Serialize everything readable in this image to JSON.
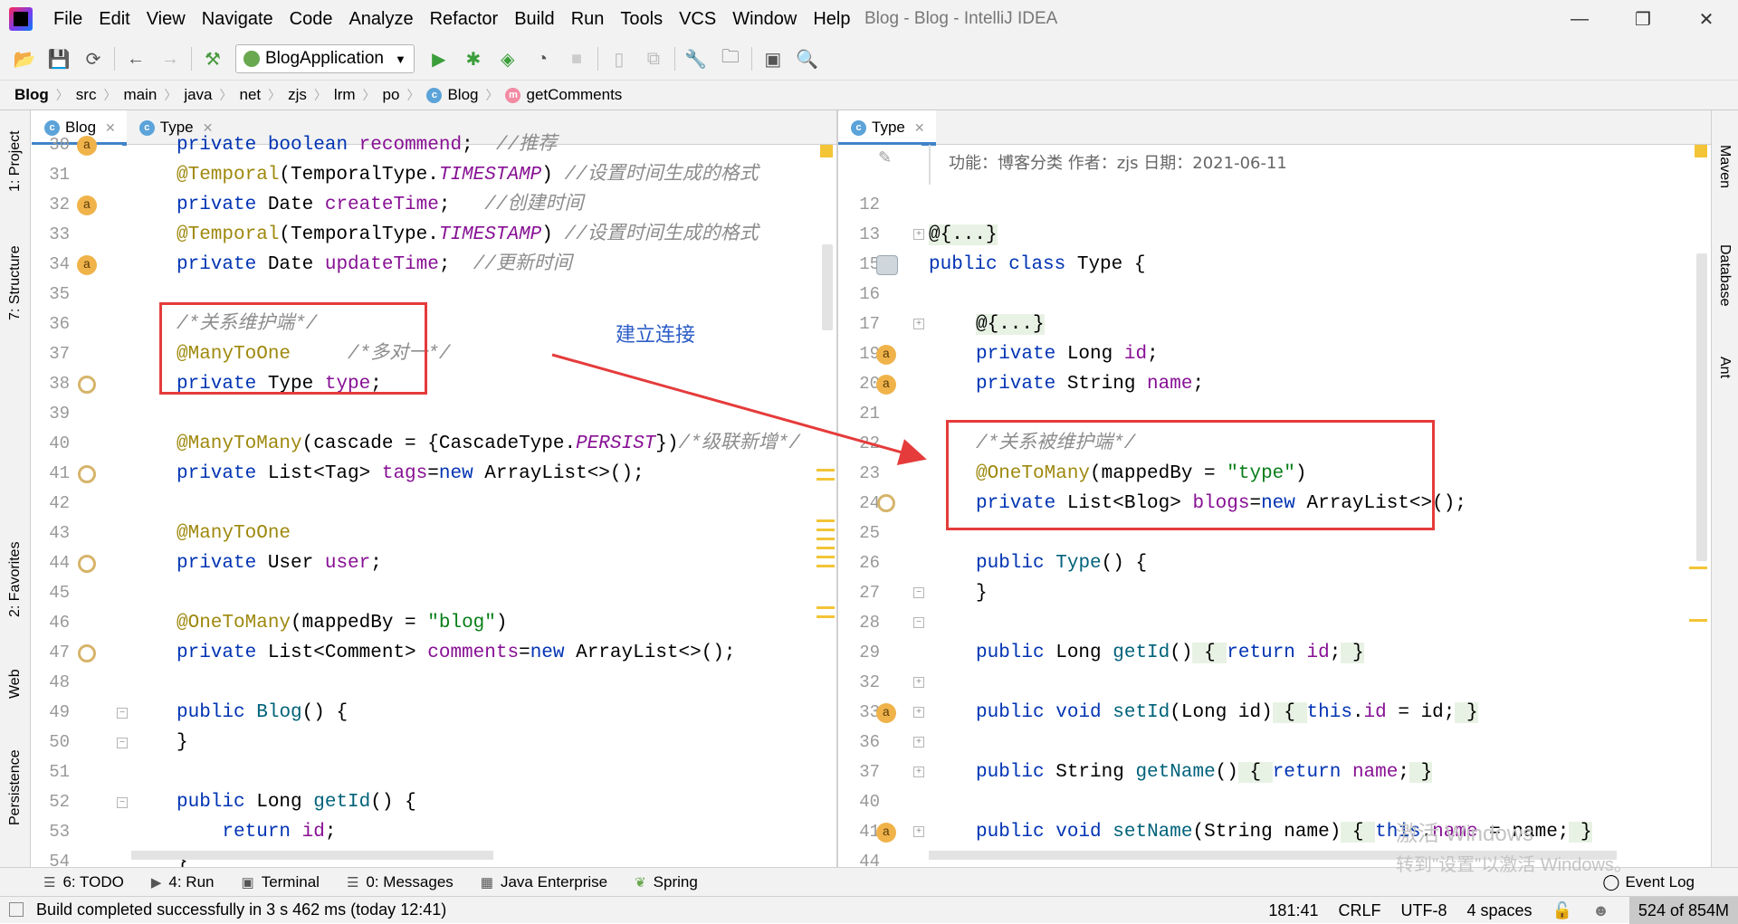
{
  "window": {
    "title": "Blog - Blog - IntelliJ IDEA",
    "min": "—",
    "restore": "❐",
    "close": "✕"
  },
  "menu": [
    "File",
    "Edit",
    "View",
    "Navigate",
    "Code",
    "Analyze",
    "Refactor",
    "Build",
    "Run",
    "Tools",
    "VCS",
    "Window",
    "Help"
  ],
  "toolbar": {
    "run_config": "BlogApplication"
  },
  "breadcrumbs": [
    "Blog",
    "src",
    "main",
    "java",
    "net",
    "zjs",
    "lrm",
    "po",
    "Blog",
    "getComments"
  ],
  "left_sidebar": {
    "project": "1: Project",
    "structure": "7: Structure",
    "favorites": "2: Favorites",
    "web": "Web",
    "persistence": "Persistence"
  },
  "right_sidebar": {
    "maven": "Maven",
    "database": "Database",
    "ant": "Ant"
  },
  "left_editor": {
    "tabs": [
      "Blog",
      "Type"
    ],
    "line_numbers": [
      "30",
      "31",
      "32",
      "33",
      "34",
      "35",
      "36",
      "37",
      "38",
      "39",
      "40",
      "41",
      "42",
      "43",
      "44",
      "45",
      "46",
      "47",
      "48",
      "49",
      "50",
      "51",
      "52",
      "53",
      "54"
    ]
  },
  "right_editor": {
    "tabs": [
      "Type"
    ],
    "doc_comment": "功能：博客分类 作者：zjs 日期：2021-06-11",
    "line_numbers": [
      "12",
      "13",
      "15",
      "16",
      "17",
      "19",
      "20",
      "21",
      "22",
      "23",
      "24",
      "25",
      "26",
      "27",
      "28",
      "29",
      "32",
      "33",
      "36",
      "37",
      "40",
      "41",
      "44"
    ]
  },
  "annotation": {
    "text": "建立连接",
    "color": "#e53b3b"
  },
  "bottom_tabs": [
    "6: TODO",
    "4: Run",
    "Terminal",
    "0: Messages",
    "Java Enterprise",
    "Spring"
  ],
  "event_log": "Event Log",
  "status": {
    "message": "Build completed successfully in 3 s 462 ms (today 12:41)",
    "position": "181:41",
    "line_sep": "CRLF",
    "encoding": "UTF-8",
    "indent": "4 spaces",
    "memory": "524 of 854M"
  },
  "watermark": {
    "line1": "激活 Windows",
    "line2": "转到\"设置\"以激活 Windows。"
  }
}
